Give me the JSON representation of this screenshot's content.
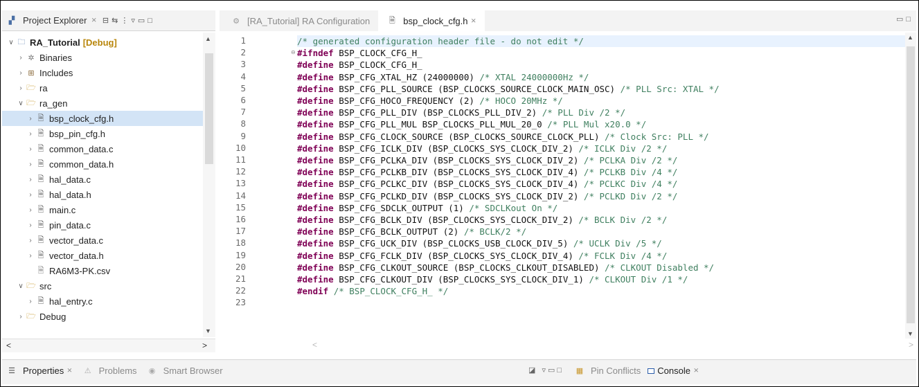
{
  "explorer": {
    "tab_label": "Project Explorer",
    "close_glyph": "⨯",
    "tree": [
      {
        "label": "RA_Tutorial",
        "suffix": "[Debug]",
        "icon": "project-icon",
        "indent": 0,
        "twisty": "∨",
        "bold": true
      },
      {
        "label": "Binaries",
        "icon": "binaries-icon",
        "indent": 1,
        "twisty": "›"
      },
      {
        "label": "Includes",
        "icon": "includes-icon",
        "indent": 1,
        "twisty": "›"
      },
      {
        "label": "ra",
        "icon": "folder-icon",
        "indent": 1,
        "twisty": "›"
      },
      {
        "label": "ra_gen",
        "icon": "folder-icon",
        "indent": 1,
        "twisty": "∨"
      },
      {
        "label": "bsp_clock_cfg.h",
        "icon": "header-file-icon",
        "indent": 2,
        "twisty": "›",
        "selected": true
      },
      {
        "label": "bsp_pin_cfg.h",
        "icon": "header-file-icon",
        "indent": 2,
        "twisty": "›"
      },
      {
        "label": "common_data.c",
        "icon": "c-file-icon",
        "indent": 2,
        "twisty": "›"
      },
      {
        "label": "common_data.h",
        "icon": "header-file-icon",
        "indent": 2,
        "twisty": "›"
      },
      {
        "label": "hal_data.c",
        "icon": "c-file-icon",
        "indent": 2,
        "twisty": "›"
      },
      {
        "label": "hal_data.h",
        "icon": "header-file-icon",
        "indent": 2,
        "twisty": "›"
      },
      {
        "label": "main.c",
        "icon": "c-file-icon",
        "indent": 2,
        "twisty": "›"
      },
      {
        "label": "pin_data.c",
        "icon": "c-file-icon",
        "indent": 2,
        "twisty": "›"
      },
      {
        "label": "vector_data.c",
        "icon": "c-file-icon",
        "indent": 2,
        "twisty": "›"
      },
      {
        "label": "vector_data.h",
        "icon": "header-file-icon",
        "indent": 2,
        "twisty": "›"
      },
      {
        "label": "RA6M3-PK.csv",
        "icon": "csv-file-icon",
        "indent": 2,
        "twisty": ""
      },
      {
        "label": "src",
        "icon": "folder-icon",
        "indent": 1,
        "twisty": "∨"
      },
      {
        "label": "hal_entry.c",
        "icon": "c-file-icon",
        "indent": 2,
        "twisty": "›"
      },
      {
        "label": "Debug",
        "icon": "folder-icon",
        "indent": 1,
        "twisty": "›"
      }
    ]
  },
  "editor": {
    "tabs": [
      {
        "label": "[RA_Tutorial] RA Configuration",
        "active": false
      },
      {
        "label": "bsp_clock_cfg.h",
        "active": true
      }
    ],
    "lines": [
      {
        "n": "1",
        "tokens": [
          [
            "cm",
            "/* generated configuration header file - do not edit */"
          ]
        ]
      },
      {
        "n": "2",
        "tokens": [
          [
            "kw",
            "#ifndef"
          ],
          [
            "",
            " BSP_CLOCK_CFG_H_"
          ]
        ],
        "fold": true
      },
      {
        "n": "3",
        "tokens": [
          [
            "kw",
            "#define"
          ],
          [
            "",
            " BSP_CLOCK_CFG_H_"
          ]
        ]
      },
      {
        "n": "4",
        "tokens": [
          [
            "kw",
            "#define"
          ],
          [
            "",
            " BSP_CFG_XTAL_HZ (24000000) "
          ],
          [
            "cm",
            "/* XTAL 24000000Hz */"
          ]
        ]
      },
      {
        "n": "5",
        "tokens": [
          [
            "kw",
            "#define"
          ],
          [
            "",
            " BSP_CFG_PLL_SOURCE (BSP_CLOCKS_SOURCE_CLOCK_MAIN_OSC) "
          ],
          [
            "cm",
            "/* PLL Src: XTAL */"
          ]
        ]
      },
      {
        "n": "6",
        "tokens": [
          [
            "kw",
            "#define"
          ],
          [
            "",
            " BSP_CFG_HOCO_FREQUENCY (2) "
          ],
          [
            "cm",
            "/* HOCO 20MHz */"
          ]
        ]
      },
      {
        "n": "7",
        "tokens": [
          [
            "kw",
            "#define"
          ],
          [
            "",
            " BSP_CFG_PLL_DIV (BSP_CLOCKS_PLL_DIV_2) "
          ],
          [
            "cm",
            "/* PLL Div /2 */"
          ]
        ]
      },
      {
        "n": "8",
        "tokens": [
          [
            "kw",
            "#define"
          ],
          [
            "",
            " BSP_CFG_PLL_MUL BSP_CLOCKS_PLL_MUL_20_0 "
          ],
          [
            "cm",
            "/* PLL Mul x20.0 */"
          ]
        ]
      },
      {
        "n": "9",
        "tokens": [
          [
            "kw",
            "#define"
          ],
          [
            "",
            " BSP_CFG_CLOCK_SOURCE (BSP_CLOCKS_SOURCE_CLOCK_PLL) "
          ],
          [
            "cm",
            "/* Clock Src: PLL */"
          ]
        ]
      },
      {
        "n": "10",
        "tokens": [
          [
            "kw",
            "#define"
          ],
          [
            "",
            " BSP_CFG_ICLK_DIV (BSP_CLOCKS_SYS_CLOCK_DIV_2) "
          ],
          [
            "cm",
            "/* ICLK Div /2 */"
          ]
        ]
      },
      {
        "n": "11",
        "tokens": [
          [
            "kw",
            "#define"
          ],
          [
            "",
            " BSP_CFG_PCLKA_DIV (BSP_CLOCKS_SYS_CLOCK_DIV_2) "
          ],
          [
            "cm",
            "/* PCLKA Div /2 */"
          ]
        ]
      },
      {
        "n": "12",
        "tokens": [
          [
            "kw",
            "#define"
          ],
          [
            "",
            " BSP_CFG_PCLKB_DIV (BSP_CLOCKS_SYS_CLOCK_DIV_4) "
          ],
          [
            "cm",
            "/* PCLKB Div /4 */"
          ]
        ]
      },
      {
        "n": "13",
        "tokens": [
          [
            "kw",
            "#define"
          ],
          [
            "",
            " BSP_CFG_PCLKC_DIV (BSP_CLOCKS_SYS_CLOCK_DIV_4) "
          ],
          [
            "cm",
            "/* PCLKC Div /4 */"
          ]
        ]
      },
      {
        "n": "14",
        "tokens": [
          [
            "kw",
            "#define"
          ],
          [
            "",
            " BSP_CFG_PCLKD_DIV (BSP_CLOCKS_SYS_CLOCK_DIV_2) "
          ],
          [
            "cm",
            "/* PCLKD Div /2 */"
          ]
        ]
      },
      {
        "n": "15",
        "tokens": [
          [
            "kw",
            "#define"
          ],
          [
            "",
            " BSP_CFG_SDCLK_OUTPUT (1) "
          ],
          [
            "cm",
            "/* SDCLKout On */"
          ]
        ]
      },
      {
        "n": "16",
        "tokens": [
          [
            "kw",
            "#define"
          ],
          [
            "",
            " BSP_CFG_BCLK_DIV (BSP_CLOCKS_SYS_CLOCK_DIV_2) "
          ],
          [
            "cm",
            "/* BCLK Div /2 */"
          ]
        ]
      },
      {
        "n": "17",
        "tokens": [
          [
            "kw",
            "#define"
          ],
          [
            "",
            " BSP_CFG_BCLK_OUTPUT (2) "
          ],
          [
            "cm",
            "/* BCLK/2 */"
          ]
        ]
      },
      {
        "n": "18",
        "tokens": [
          [
            "kw",
            "#define"
          ],
          [
            "",
            " BSP_CFG_UCK_DIV (BSP_CLOCKS_USB_CLOCK_DIV_5) "
          ],
          [
            "cm",
            "/* UCLK Div /5 */"
          ]
        ]
      },
      {
        "n": "19",
        "tokens": [
          [
            "kw",
            "#define"
          ],
          [
            "",
            " BSP_CFG_FCLK_DIV (BSP_CLOCKS_SYS_CLOCK_DIV_4) "
          ],
          [
            "cm",
            "/* FCLK Div /4 */"
          ]
        ]
      },
      {
        "n": "20",
        "tokens": [
          [
            "kw",
            "#define"
          ],
          [
            "",
            " BSP_CFG_CLKOUT_SOURCE (BSP_CLOCKS_CLKOUT_DISABLED) "
          ],
          [
            "cm",
            "/* CLKOUT Disabled */"
          ]
        ]
      },
      {
        "n": "21",
        "tokens": [
          [
            "kw",
            "#define"
          ],
          [
            "",
            " BSP_CFG_CLKOUT_DIV (BSP_CLOCKS_SYS_CLOCK_DIV_1) "
          ],
          [
            "cm",
            "/* CLKOUT Div /1 */"
          ]
        ]
      },
      {
        "n": "22",
        "tokens": [
          [
            "kw",
            "#endif"
          ],
          [
            "",
            " "
          ],
          [
            "cm",
            "/* BSP_CLOCK_CFG_H_ */"
          ]
        ]
      },
      {
        "n": "23",
        "tokens": []
      }
    ]
  },
  "bottom": {
    "left_tabs": [
      {
        "label": "Properties",
        "active": true,
        "close": true
      },
      {
        "label": "Problems",
        "active": false
      },
      {
        "label": "Smart Browser",
        "active": false
      }
    ],
    "right_tabs": [
      {
        "label": "Pin Conflicts",
        "active": false
      },
      {
        "label": "Console",
        "active": true,
        "close": true
      }
    ]
  }
}
